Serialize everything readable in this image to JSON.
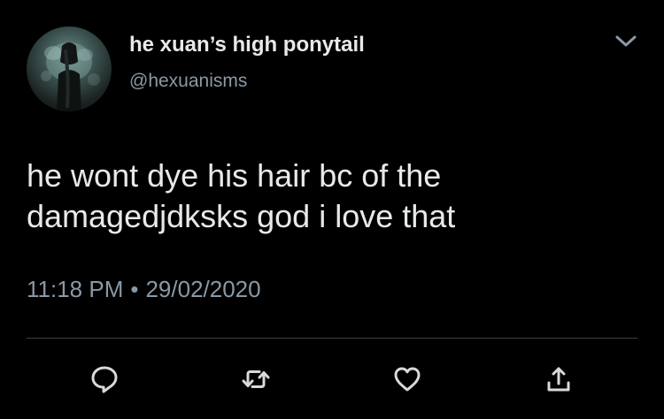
{
  "tweet": {
    "display_name": "he xuan’s high ponytail",
    "handle": "@hexuanisms",
    "text_lines": [
      "he wont dye his hair bc of the",
      "damagedjdksks god i love that"
    ],
    "time": "11:18 PM",
    "separator": "•",
    "date": "29/02/2020"
  },
  "actions": {
    "reply_icon": "reply-icon",
    "retweet_icon": "retweet-icon",
    "like_icon": "heart-icon",
    "share_icon": "share-icon",
    "menu_icon": "chevron-down-icon"
  },
  "colors": {
    "background": "#000000",
    "text": "#e7e9ea",
    "secondary": "#8b98a5",
    "icon": "#d9d9d9",
    "divider": "#38444d"
  }
}
